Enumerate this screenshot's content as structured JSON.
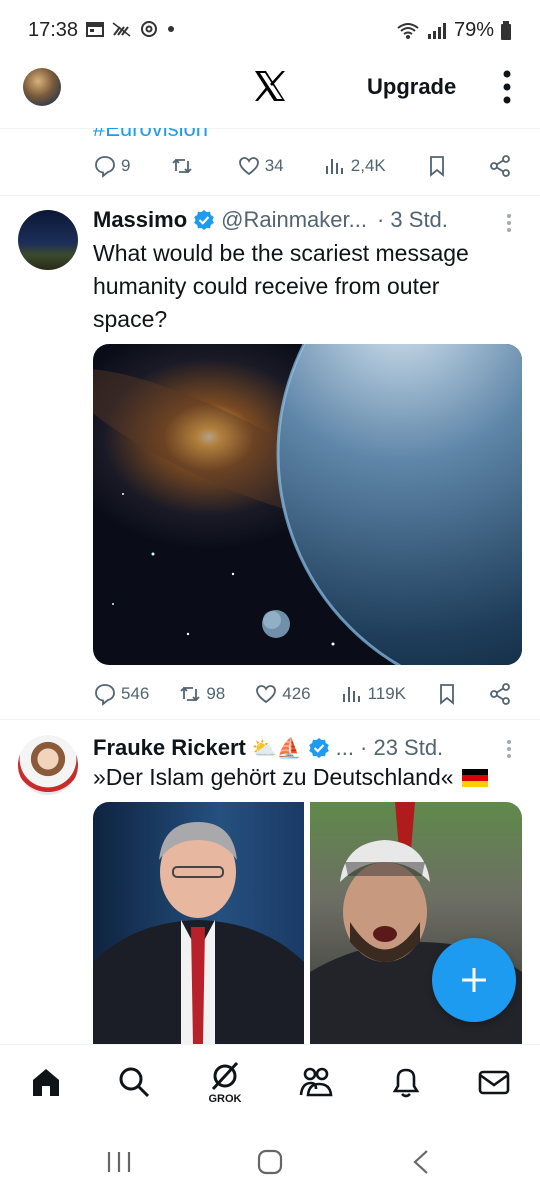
{
  "status_bar": {
    "time": "17:38",
    "battery": "79%"
  },
  "header": {
    "upgrade_label": "Upgrade"
  },
  "tweet_partial": {
    "hashtag": "#Eurovision",
    "replies": "9",
    "reposts": "",
    "likes": "34",
    "views": "2,4K"
  },
  "tweet1": {
    "name": "Massimo",
    "handle": "@Rainmaker...",
    "time": "· 3 Std.",
    "text": "What would be the scariest message humanity could receive from outer space?",
    "replies": "546",
    "reposts": "98",
    "likes": "426",
    "views": "119K"
  },
  "tweet2": {
    "name": "Frauke Rickert",
    "name_emojis": "⛅⛵",
    "handle": "...",
    "time": "· 23 Std.",
    "text": "»Der Islam gehört zu Deutschland«"
  },
  "bottom_nav": {
    "grok_label": "GROK"
  },
  "colors": {
    "accent": "#1d9bf0",
    "text": "#0f1419",
    "muted": "#536471"
  }
}
